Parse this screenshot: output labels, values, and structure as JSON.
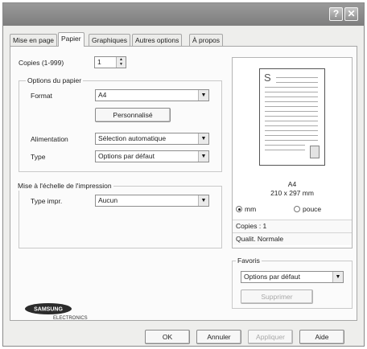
{
  "titlebar": {
    "help_label": "?",
    "close_label": "✕"
  },
  "tabs": [
    {
      "label": "Mise en page"
    },
    {
      "label": "Papier"
    },
    {
      "label": "Graphiques"
    },
    {
      "label": "Autres options"
    },
    {
      "label": "À propos"
    }
  ],
  "copies": {
    "label": "Copies (1-999)",
    "value": "1"
  },
  "paper_options": {
    "title": "Options du papier",
    "format_label": "Format",
    "format_value": "A4",
    "custom_button": "Personnalisé",
    "source_label": "Alimentation",
    "source_value": "Sélection automatique",
    "type_label": "Type",
    "type_value": "Options par défaut"
  },
  "scaling": {
    "title": "Mise à l'échelle de l'impression",
    "type_label": "Type impr.",
    "type_value": "Aucun"
  },
  "preview": {
    "page_letter": "S",
    "size_name": "A4",
    "size_dims": "210 x 297 mm",
    "unit_mm": "mm",
    "unit_inch": "pouce",
    "copies_text": "Copies : 1",
    "quality_text": "Qualit. Normale"
  },
  "favorites": {
    "title": "Favoris",
    "value": "Options par défaut",
    "delete_button": "Supprimer"
  },
  "brand": {
    "name": "SAMSUNG",
    "sub": "ELECTRONICS"
  },
  "footer": {
    "ok": "OK",
    "cancel": "Annuler",
    "apply": "Appliquer",
    "help": "Aide"
  }
}
